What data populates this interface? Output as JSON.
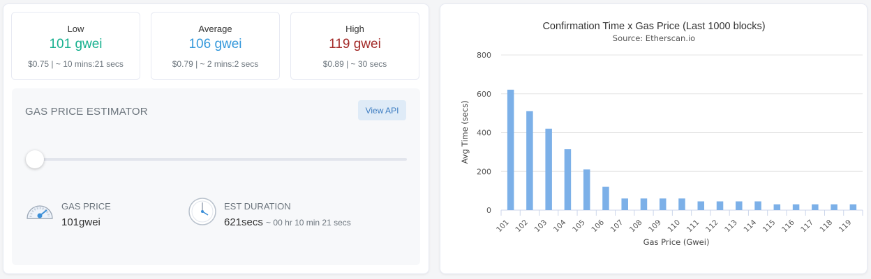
{
  "cards": {
    "low": {
      "label": "Low",
      "value": "101 gwei",
      "sub": "$0.75 | ~ 10 mins:21 secs",
      "color": "#17b08f"
    },
    "average": {
      "label": "Average",
      "value": "106 gwei",
      "sub": "$0.79 | ~ 2 mins:2 secs",
      "color": "#3498db"
    },
    "high": {
      "label": "High",
      "value": "119 gwei",
      "sub": "$0.89 | ~ 30 secs",
      "color": "#a42c2a"
    }
  },
  "estimator": {
    "title": "GAS PRICE ESTIMATOR",
    "view_api": "View API",
    "slider_fraction": 0.0,
    "gas_price_label": "GAS PRICE",
    "gas_price_value": "101gwei",
    "est_duration_label": "EST DURATION",
    "est_duration_value": "621secs",
    "est_duration_detail": "~ 00 hr 10 min 21 secs"
  },
  "icons": {
    "gauge": "speedometer-icon",
    "clock": "clock-icon"
  },
  "chart_data": {
    "type": "bar",
    "title": "Confirmation Time x Gas Price (Last 1000 blocks)",
    "subtitle": "Source: Etherscan.io",
    "xlabel": "Gas Price (Gwei)",
    "ylabel": "Avg Time (secs)",
    "ylim": [
      0,
      800
    ],
    "yticks": [
      0,
      200,
      400,
      600,
      800
    ],
    "grid": true,
    "bar_color": "#7cb0e8",
    "categories": [
      "101",
      "102",
      "103",
      "104",
      "105",
      "106",
      "107",
      "108",
      "109",
      "110",
      "111",
      "112",
      "113",
      "114",
      "115",
      "116",
      "117",
      "118",
      "119"
    ],
    "values": [
      621,
      510,
      420,
      315,
      210,
      120,
      60,
      60,
      60,
      60,
      45,
      45,
      45,
      45,
      30,
      30,
      30,
      30,
      30
    ]
  }
}
